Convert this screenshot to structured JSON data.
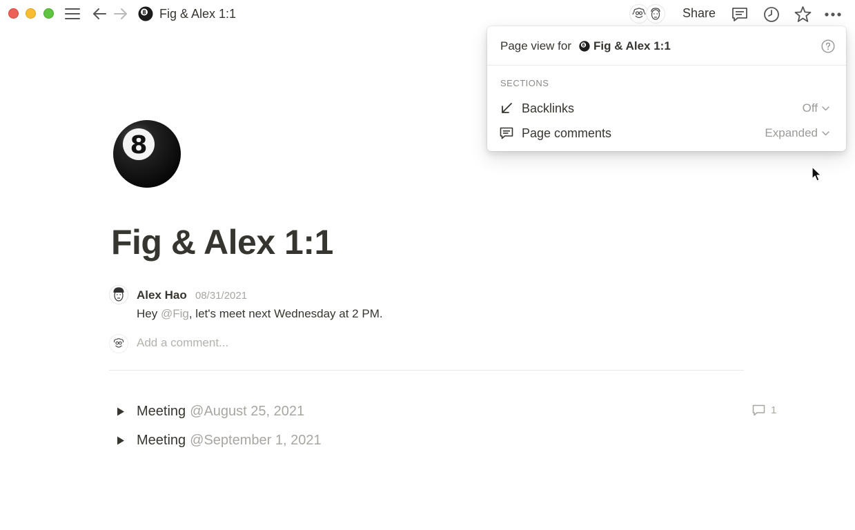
{
  "window": {
    "title": "Fig & Alex 1:1",
    "share_label": "Share"
  },
  "page": {
    "title": "Fig & Alex 1:1",
    "icon": "8-ball-icon"
  },
  "comment": {
    "author": "Alex Hao",
    "date": "08/31/2021",
    "text_before": "Hey ",
    "mention": "@Fig",
    "text_after": ", let's meet next Wednesday at 2 PM.",
    "add_placeholder": "Add a comment..."
  },
  "toggles": [
    {
      "label": "Meeting",
      "date": "@August 25, 2021",
      "comment_count": "1"
    },
    {
      "label": "Meeting",
      "date": "@September 1, 2021"
    }
  ],
  "popup": {
    "header_prefix": "Page view for",
    "header_page": "Fig & Alex 1:1",
    "sections_label": "SECTIONS",
    "rows": [
      {
        "label": "Backlinks",
        "value": "Off",
        "icon": "backlinks-arrow-icon"
      },
      {
        "label": "Page comments",
        "value": "Expanded",
        "icon": "comment-icon"
      }
    ]
  },
  "colors": {
    "text": "#37352f",
    "muted": "#a8a6a1",
    "close": "#ee5f57",
    "minimize": "#f5bd2f",
    "zoom": "#5fc43f"
  }
}
